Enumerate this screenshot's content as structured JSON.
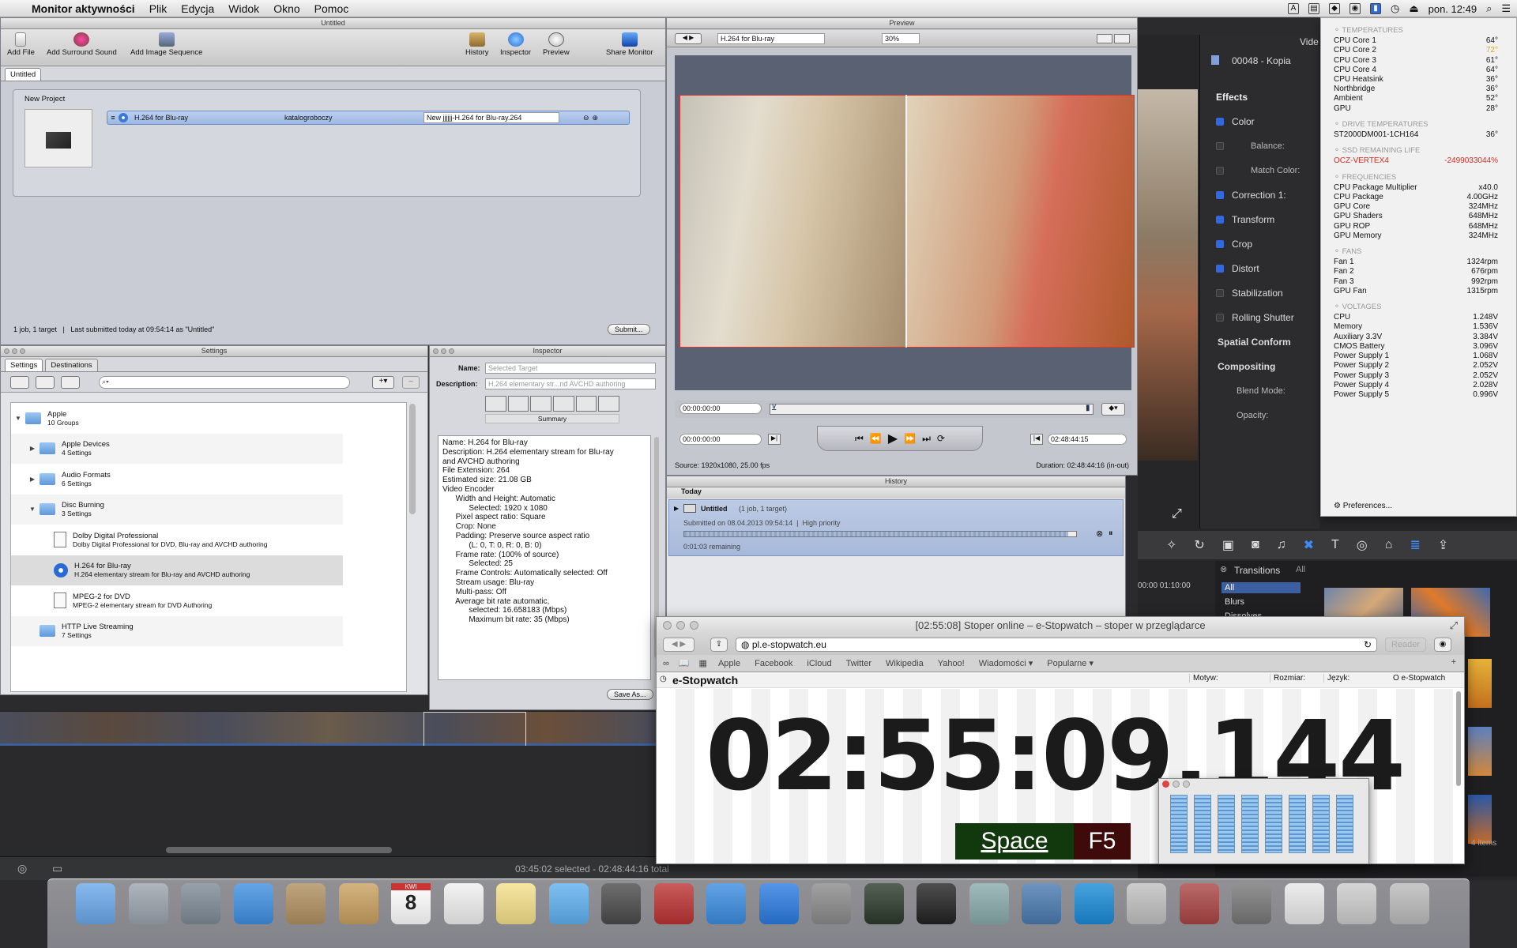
{
  "menubar": {
    "app_name": "Monitor aktywności",
    "menus": [
      "Plik",
      "Edycja",
      "Widok",
      "Okno",
      "Pomoc"
    ],
    "clock": "pon. 12:49"
  },
  "compressor": {
    "title": "Untitled",
    "toolbar": [
      "Add File",
      "Add Surround Sound",
      "Add Image Sequence",
      "History",
      "Inspector",
      "Preview",
      "Share Monitor"
    ],
    "tab": "Untitled",
    "project_label": "New Project",
    "job_setting": "H.264 for Blu-ray",
    "job_destination": "katalogroboczy",
    "job_output": "New jjjjjj-H.264 for Blu-ray.264",
    "status": "1 job, 1 target   |   Last submitted today at 09:54:14 as \"Untitled\"",
    "submit_label": "Submit..."
  },
  "settings": {
    "title": "Settings",
    "tabs": [
      "Settings",
      "Destinations"
    ],
    "groups": [
      {
        "name": "Apple",
        "sub": "10 Groups",
        "kind": "folder"
      },
      {
        "name": "Apple Devices",
        "sub": "4 Settings",
        "kind": "folder"
      },
      {
        "name": "Audio Formats",
        "sub": "6 Settings",
        "kind": "folder"
      },
      {
        "name": "Disc Burning",
        "sub": "3 Settings",
        "kind": "folder"
      },
      {
        "name": "Dolby Digital Professional",
        "sub": "Dolby Digital Professional for DVD, Blu-ray and AVCHD authoring",
        "kind": "file"
      },
      {
        "name": "H.264 for Blu-ray",
        "sub": "H.264 elementary stream for Blu-ray and AVCHD authoring",
        "kind": "disc"
      },
      {
        "name": "MPEG-2 for DVD",
        "sub": "MPEG-2 elementary stream for DVD Authoring",
        "kind": "file"
      },
      {
        "name": "HTTP Live Streaming",
        "sub": "7 Settings",
        "kind": "folder"
      }
    ]
  },
  "inspector": {
    "title": "Inspector",
    "name_label": "Name:",
    "name_value": "Selected Target",
    "desc_label": "Description:",
    "desc_value": "H.264 elementary str...nd AVCHD authoring",
    "summary_label": "Summary",
    "lines": [
      "Name: H.264 for Blu-ray",
      "Description: H.264 elementary stream for Blu-ray",
      "and AVCHD authoring",
      "File Extension: 264",
      "Estimated size: 21.08 GB",
      "Video Encoder",
      "      Width and Height: Automatic",
      "            Selected: 1920 x 1080",
      "      Pixel aspect ratio: Square",
      "      Crop: None",
      "      Padding: Preserve source aspect ratio",
      "            (L: 0, T: 0, R: 0, B: 0)",
      "      Frame rate: (100% of source)",
      "            Selected: 25",
      "      Frame Controls: Automatically selected: Off",
      "      Stream usage: Blu-ray",
      "      Multi-pass: Off",
      "      Average bit rate automatic,",
      "            selected: 16.658183 (Mbps)",
      "            Maximum bit rate: 35 (Mbps)"
    ],
    "save_label": "Save As..."
  },
  "preview": {
    "title": "Preview",
    "setting": "H.264 for Blu-ray",
    "zoom": "30%",
    "timecode_top": "00:00:00:00",
    "timecode_in": "00:00:00:00",
    "timecode_out": "02:48:44:15",
    "source": "Source: 1920x1080, 25.00 fps",
    "duration": "Duration: 02:48:44:16 (in-out)"
  },
  "history": {
    "title": "History",
    "today": "Today",
    "job_name": "Untitled",
    "job_meta": "(1 job, 1 target)",
    "submitted": "Submitted on 08.04.2013 09:54:14  |  High priority",
    "progress": 0.98,
    "remaining": "0:01:03 remaining"
  },
  "fcp": {
    "tab_right": "Vide",
    "clip_name": "00048 - Kopia",
    "effects_header": "Effects",
    "items": [
      {
        "label": "Color",
        "on": true
      },
      {
        "label": "Balance:",
        "on": false,
        "indent": true
      },
      {
        "label": "Match Color:",
        "on": false,
        "indent": true
      },
      {
        "label": "Correction 1:",
        "on": true
      },
      {
        "label": "Transform",
        "on": true
      },
      {
        "label": "Crop",
        "on": true
      },
      {
        "label": "Distort",
        "on": true
      },
      {
        "label": "Stabilization",
        "on": false
      },
      {
        "label": "Rolling Shutter",
        "on": false
      },
      {
        "label": "Spatial Conform",
        "on": null
      },
      {
        "label": "Compositing",
        "on": null
      },
      {
        "label": "Blend Mode:",
        "on": null,
        "indent": true
      },
      {
        "label": "Opacity:",
        "on": null,
        "indent": true
      }
    ],
    "transitions_label": "Transitions",
    "transitions_filter": "All",
    "transitions_list": [
      "All",
      "Blurs",
      "Dissolves"
    ],
    "timeline_tc": "00:00   01:10:00",
    "items_count": "4 items",
    "selection_status": "03:45:02 selected - 02:48:44:16 total"
  },
  "istat": {
    "sections": [
      {
        "title": "TEMPERATURES",
        "rows": [
          [
            "CPU Core 1",
            "64°"
          ],
          [
            "CPU Core 2",
            "72°"
          ],
          [
            "CPU Core 3",
            "61°"
          ],
          [
            "CPU Core 4",
            "64°"
          ],
          [
            "CPU Heatsink",
            "36°"
          ],
          [
            "Northbridge",
            "36°"
          ],
          [
            "Ambient",
            "52°"
          ],
          [
            "GPU",
            "28°"
          ]
        ]
      },
      {
        "title": "DRIVE TEMPERATURES",
        "rows": [
          [
            "ST2000DM001-1CH164",
            "36°"
          ]
        ]
      },
      {
        "title": "SSD REMAINING LIFE",
        "rows": [
          [
            "OCZ-VERTEX4",
            "-2499033044%"
          ]
        ]
      },
      {
        "title": "FREQUENCIES",
        "rows": [
          [
            "CPU Package Multiplier",
            "x40.0"
          ],
          [
            "CPU Package",
            "4.00GHz"
          ],
          [
            "GPU Core",
            "324MHz"
          ],
          [
            "GPU Shaders",
            "648MHz"
          ],
          [
            "GPU ROP",
            "648MHz"
          ],
          [
            "GPU Memory",
            "324MHz"
          ]
        ]
      },
      {
        "title": "FANS",
        "rows": [
          [
            "Fan 1",
            "1324rpm"
          ],
          [
            "Fan 2",
            "676rpm"
          ],
          [
            "Fan 3",
            "992rpm"
          ],
          [
            "GPU Fan",
            "1315rpm"
          ]
        ]
      },
      {
        "title": "VOLTAGES",
        "rows": [
          [
            "CPU",
            "1.248V"
          ],
          [
            "Memory",
            "1.536V"
          ],
          [
            "Auxiliary 3.3V",
            "3.384V"
          ],
          [
            "CMOS Battery",
            "3.096V"
          ],
          [
            "Power Supply 1",
            "1.068V"
          ],
          [
            "Power Supply 2",
            "2.052V"
          ],
          [
            "Power Supply 3",
            "2.052V"
          ],
          [
            "Power Supply 4",
            "2.028V"
          ],
          [
            "Power Supply 5",
            "0.996V"
          ]
        ]
      }
    ],
    "preferences": "Preferences...",
    "warn_color": "#e8a317",
    "err_color": "#d62d20"
  },
  "safari": {
    "title": "[02:55:08] Stoper online – e-Stopwatch – stoper w przeglądarce",
    "url": "pl.e-stopwatch.eu",
    "reader": "Reader",
    "bookmarks": [
      "Apple",
      "Facebook",
      "iCloud",
      "Twitter",
      "Wikipedia",
      "Yahoo!",
      "Wiadomości ▾",
      "Popularne ▾"
    ],
    "site_name": "e-Stopwatch",
    "theme_label": "Motyw:",
    "size_label": "Rozmiar:",
    "lang_label": "Język:",
    "about_label": "O e-Stopwatch",
    "timer": "02:55:09.144",
    "space_key": "Space",
    "f5_key": "F5"
  },
  "levels_meter": {
    "levels": [
      0.93,
      0.93,
      0.93,
      0.93,
      0.93,
      0.93,
      0.93,
      0.93
    ]
  },
  "dock": {
    "icons": [
      "finder-icon",
      "launchpad-icon",
      "image-capture-icon",
      "safari-icon",
      "mail-icon",
      "contacts-icon",
      "calendar-icon",
      "reminders-icon",
      "notes-icon",
      "messages-icon",
      "facetime-icon",
      "dvd-player-icon",
      "itunes-icon",
      "app-store-icon",
      "system-preferences-icon",
      "activity-monitor-icon",
      "terminal-icon",
      "preview-icon",
      "istat-icon",
      "teamviewer-icon",
      "instruments-icon",
      "final-cut-pro-icon",
      "compressor-icon",
      "documents-icon",
      "stack-icon",
      "trash-icon"
    ],
    "calendar_day": "8",
    "calendar_month": "KWI"
  }
}
